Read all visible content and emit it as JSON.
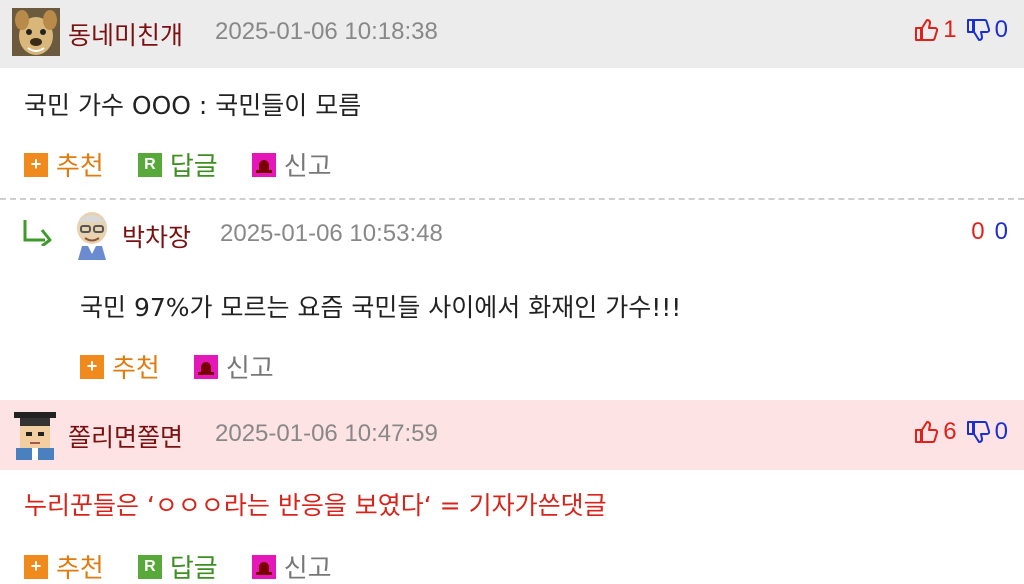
{
  "comments": [
    {
      "nickname": "동네미친개",
      "date": "2025-01-06 10:18:38",
      "votes": {
        "up": "1",
        "down": "0"
      },
      "text": "국민 가수 OOO : 국민들이 모름",
      "actions": {
        "recommend": "추천",
        "reply": "답글",
        "report": "신고"
      }
    },
    {
      "nickname": "박차장",
      "date": "2025-01-06 10:53:48",
      "votes": {
        "up": "0",
        "down": "0"
      },
      "text": "국민 97%가 모르는 요즘 국민들 사이에서 화재인 가수!!!",
      "actions": {
        "recommend": "추천",
        "report": "신고"
      }
    },
    {
      "nickname": "쫄리면쫄면",
      "date": "2025-01-06 10:47:59",
      "votes": {
        "up": "6",
        "down": "0"
      },
      "text": "누리꾼들은 ‘ㅇㅇㅇ라는 반응을 보였다‘ = 기자가쓴댓글",
      "actions": {
        "recommend": "추천",
        "reply": "답글",
        "report": "신고"
      }
    }
  ],
  "icons": {
    "thumbs_up": "thumbs-up-icon",
    "thumbs_down": "thumbs-down-icon",
    "recommend": "plus-icon",
    "reply": "reply-r-icon",
    "report": "siren-icon",
    "reply_arrow": "reply-arrow-icon"
  },
  "colors": {
    "header_gray": "#ececec",
    "header_pink": "#fde3e3",
    "nickname": "#7a1010",
    "up_vote": "#e0201b",
    "down_vote": "#1b2fd0",
    "recommend": "#e07b10",
    "reply": "#3e8f22",
    "report": "#e418b8",
    "red_text": "#d8231a"
  }
}
